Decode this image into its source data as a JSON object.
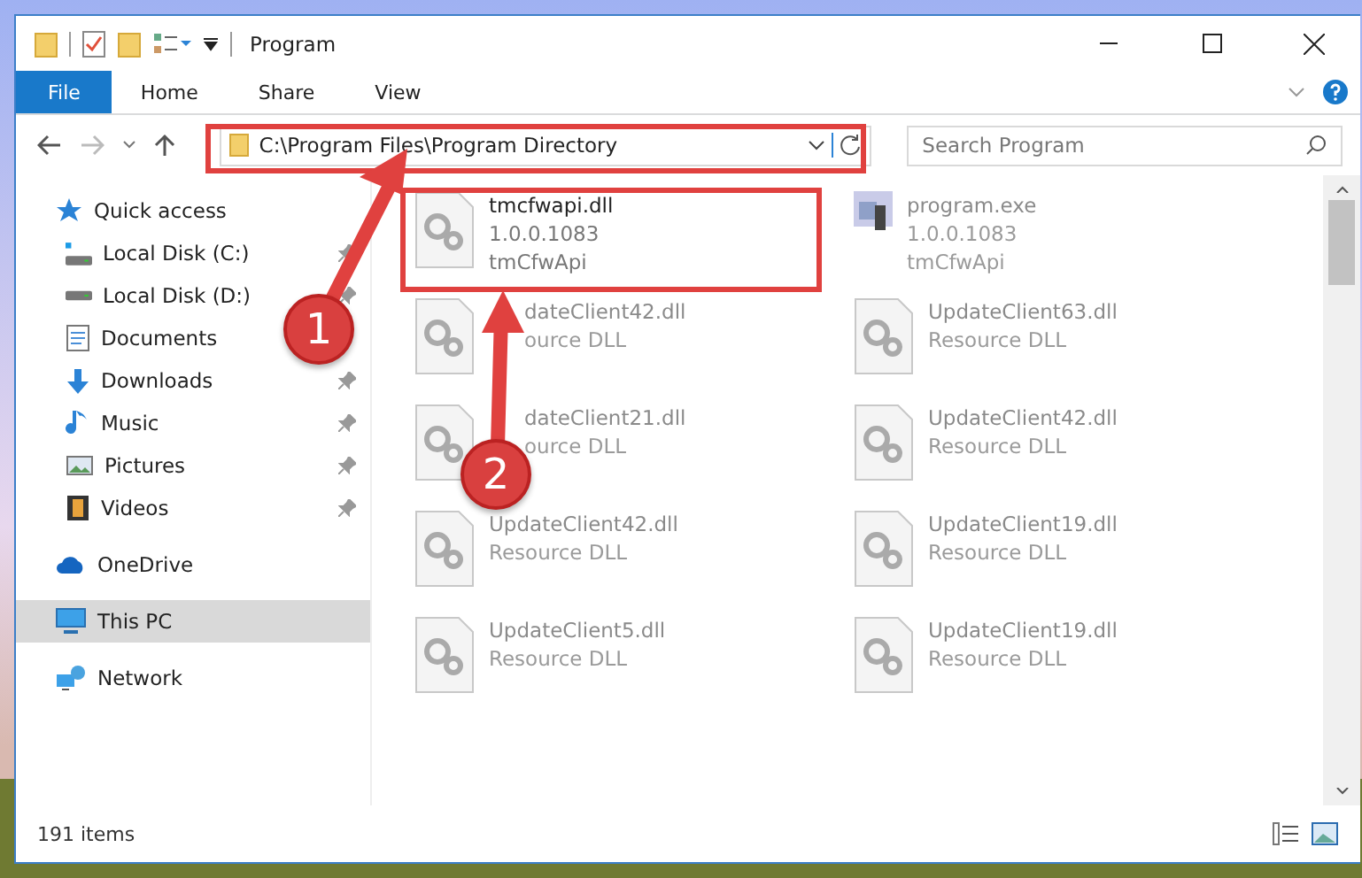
{
  "window": {
    "title": "Program"
  },
  "ribbon_tabs": [
    {
      "label": "File",
      "kind": "file"
    },
    {
      "label": "Home",
      "kind": "tab"
    },
    {
      "label": "Share",
      "kind": "tab"
    },
    {
      "label": "View",
      "kind": "tab"
    }
  ],
  "address": {
    "path": "C:\\Program Files\\Program Directory"
  },
  "search": {
    "placeholder": "Search Program"
  },
  "sidebar": {
    "items": [
      {
        "label": "Quick access",
        "kind": "star",
        "selected": false,
        "children": [
          {
            "label": "Local Disk (C:)",
            "kind": "drive-c",
            "pinned": true,
            "selected": false
          },
          {
            "label": "Local Disk (D:)",
            "kind": "drive",
            "pinned": true,
            "selected": false
          },
          {
            "label": "Documents",
            "kind": "documents",
            "pinned": false,
            "selected": false
          },
          {
            "label": "Downloads",
            "kind": "downloads",
            "pinned": true,
            "selected": false
          },
          {
            "label": "Music",
            "kind": "music",
            "pinned": true,
            "selected": false
          },
          {
            "label": "Pictures",
            "kind": "pictures",
            "pinned": true,
            "selected": false
          },
          {
            "label": "Videos",
            "kind": "videos",
            "pinned": true,
            "selected": false
          }
        ]
      },
      {
        "label": "OneDrive",
        "kind": "cloud",
        "selected": false
      },
      {
        "label": "This PC",
        "kind": "pc",
        "selected": true
      },
      {
        "label": "Network",
        "kind": "network",
        "selected": false
      }
    ]
  },
  "files": [
    {
      "kind": "dll",
      "blurred": false,
      "clipped": false,
      "lines": [
        "tmcfwapi.dll",
        "1.0.0.1083",
        "tmCfwApi"
      ]
    },
    {
      "kind": "exe",
      "blurred": true,
      "clipped": false,
      "lines": [
        "program.exe",
        "1.0.0.1083",
        "tmCfwApi"
      ]
    },
    {
      "kind": "dll",
      "blurred": true,
      "clipped": true,
      "lines": [
        "dateClient42.dll",
        "ource DLL"
      ]
    },
    {
      "kind": "dll",
      "blurred": true,
      "clipped": false,
      "lines": [
        "UpdateClient63.dll",
        "Resource DLL"
      ]
    },
    {
      "kind": "dll",
      "blurred": true,
      "clipped": true,
      "lines": [
        "dateClient21.dll",
        "ource DLL"
      ]
    },
    {
      "kind": "dll",
      "blurred": true,
      "clipped": false,
      "lines": [
        "UpdateClient42.dll",
        "Resource DLL"
      ]
    },
    {
      "kind": "dll",
      "blurred": true,
      "clipped": false,
      "lines": [
        "UpdateClient42.dll",
        "Resource DLL"
      ]
    },
    {
      "kind": "dll",
      "blurred": true,
      "clipped": false,
      "lines": [
        "UpdateClient19.dll",
        "Resource DLL"
      ]
    },
    {
      "kind": "dll",
      "blurred": true,
      "clipped": false,
      "lines": [
        "UpdateClient5.dll",
        "Resource DLL"
      ]
    },
    {
      "kind": "dll",
      "blurred": true,
      "clipped": false,
      "lines": [
        "UpdateClient19.dll",
        "Resource DLL"
      ]
    }
  ],
  "status_bar": {
    "count": "191 items"
  },
  "annotations": [
    {
      "label": "1"
    },
    {
      "label": "2"
    }
  ]
}
